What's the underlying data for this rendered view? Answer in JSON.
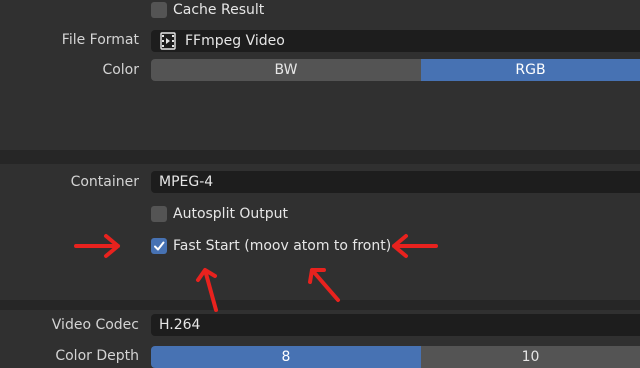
{
  "output": {
    "cache_result_label": "Cache Result",
    "file_format_label": "File Format",
    "file_format_value": "FFmpeg Video",
    "file_format_icon": "film-icon",
    "color_label": "Color",
    "color_options": [
      "BW",
      "RGB"
    ],
    "color_selected": "RGB"
  },
  "encoding": {
    "container_label": "Container",
    "container_value": "MPEG-4",
    "autosplit_label": "Autosplit Output",
    "autosplit_checked": false,
    "fast_start_label": "Fast Start (moov atom to front)",
    "fast_start_checked": true
  },
  "video": {
    "codec_label": "Video Codec",
    "codec_value": "H.264",
    "color_depth_label": "Color Depth",
    "color_depth_options": [
      "8",
      "10"
    ],
    "color_depth_selected": "8"
  },
  "annotations": {
    "arrow_color": "#e8221e"
  },
  "colors": {
    "accent": "#4772b3",
    "panel_bg": "#303030",
    "field_bg": "#1d1d1d",
    "button_bg": "#545454"
  }
}
